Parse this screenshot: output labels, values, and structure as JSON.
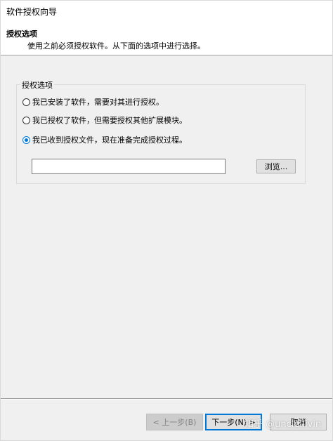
{
  "window": {
    "title": "软件授权向导"
  },
  "header": {
    "title": "授权选项",
    "description": "使用之前必须授权软件。从下面的选项中进行选择。"
  },
  "group": {
    "label": "授权选项",
    "options": [
      {
        "label": "我已安装了软件，需要对其进行授权。",
        "checked": false
      },
      {
        "label": "我已授权了软件，但需要授权其他扩展模块。",
        "checked": false
      },
      {
        "label": "我已收到授权文件，现在准备完成授权过程。",
        "checked": true
      }
    ],
    "file_path_value": "",
    "browse_label": "浏览..."
  },
  "footer": {
    "back_label": "< 上一步(B)",
    "next_label": "下一步(N) >",
    "cancel_label": "取消"
  },
  "watermark": "知乎 @uncle.livin",
  "colors": {
    "accent": "#0078d7",
    "background": "#f0f0f0",
    "header_background": "#ffffff"
  }
}
